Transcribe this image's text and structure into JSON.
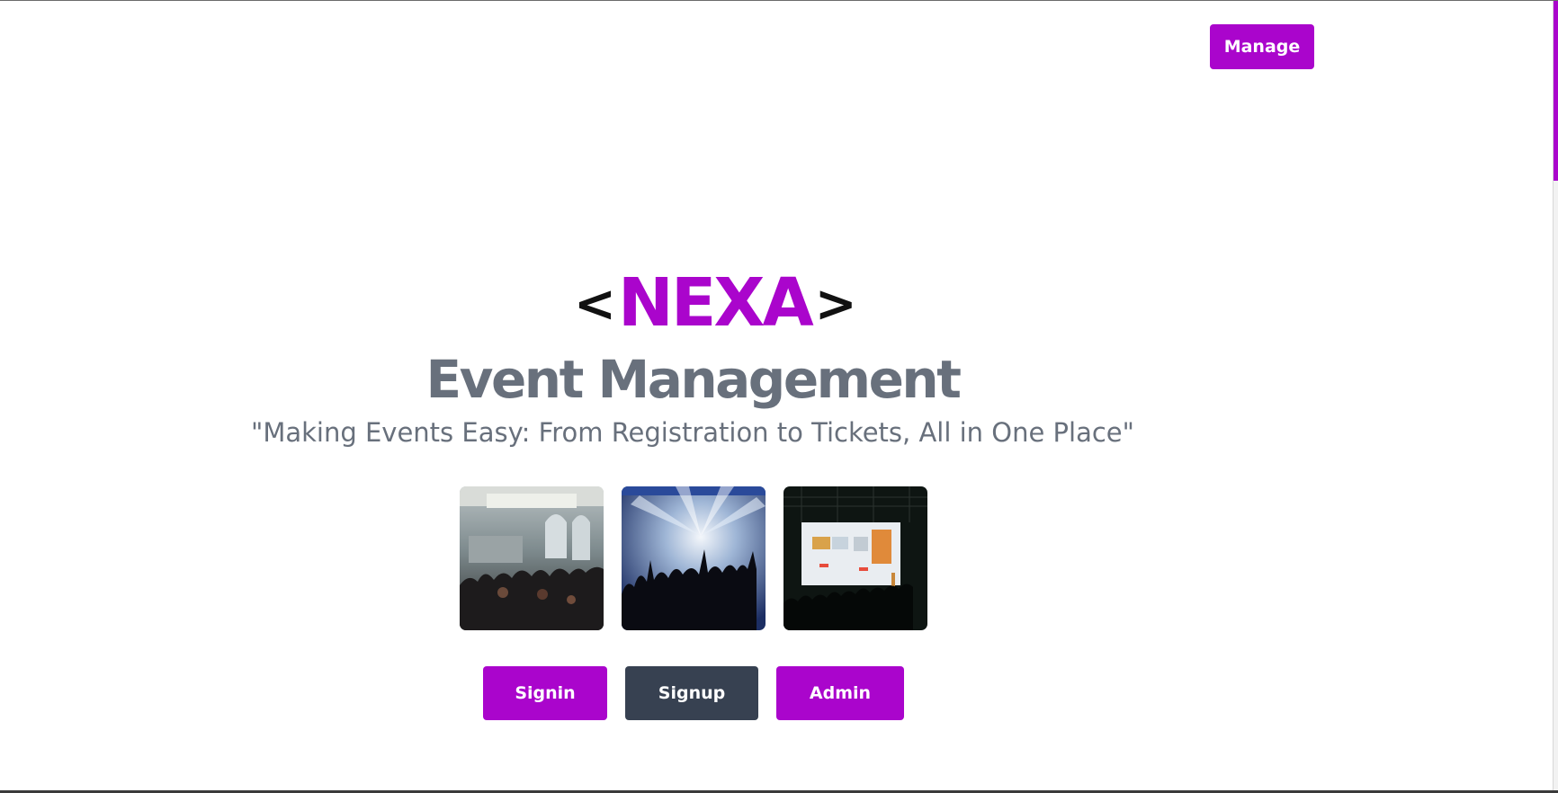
{
  "header": {
    "manage_label": "Manage"
  },
  "hero": {
    "logo_left": "<",
    "logo_word": "NEXA",
    "logo_right": ">",
    "title": "Event Management",
    "tagline": "\"Making Events Easy: From Registration to Tickets, All in One Place\""
  },
  "gallery": {
    "images": [
      {
        "icon": "concert-hall-crowd-image"
      },
      {
        "icon": "stage-lights-concert-image"
      },
      {
        "icon": "presentation-screen-audience-image"
      }
    ]
  },
  "actions": {
    "signin_label": "Signin",
    "signup_label": "Signup",
    "admin_label": "Admin"
  },
  "colors": {
    "accent": "#aa05cc",
    "dark_button": "#374151",
    "text_gray": "#68707c"
  }
}
